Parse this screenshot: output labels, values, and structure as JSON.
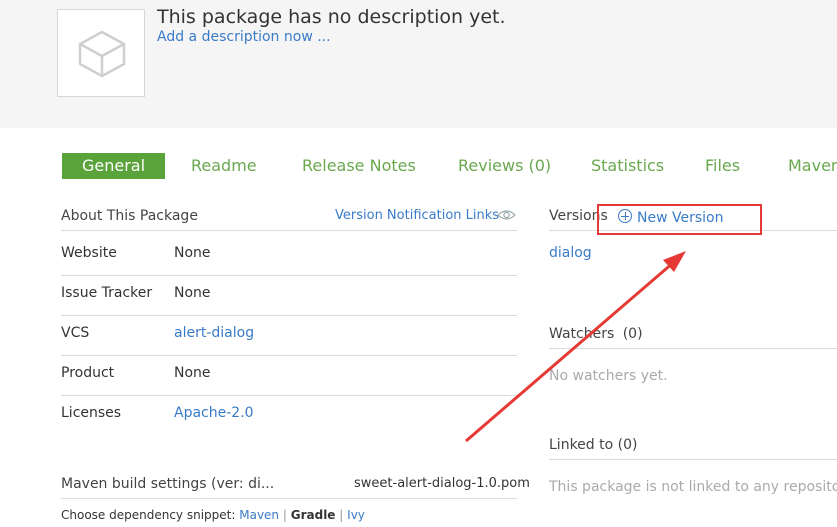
{
  "header": {
    "description": "This package has no description yet.",
    "add_description_link": "Add a description now ..."
  },
  "tabs": [
    {
      "label": "General",
      "active": true
    },
    {
      "label": "Readme"
    },
    {
      "label": "Release Notes"
    },
    {
      "label": "Reviews (0)"
    },
    {
      "label": "Statistics"
    },
    {
      "label": "Files"
    },
    {
      "label": "Maven"
    }
  ],
  "about": {
    "title": "About This Package",
    "notification_link": "Version Notification Links",
    "rows": [
      {
        "label": "Website",
        "value": "None"
      },
      {
        "label": "Issue Tracker",
        "value": "None"
      },
      {
        "label": "VCS",
        "value": "alert-dialog"
      },
      {
        "label": "Product",
        "value": "None"
      },
      {
        "label": "Licenses",
        "value": "Apache-2.0"
      }
    ]
  },
  "maven": {
    "title": "Maven build settings (ver: di...",
    "pom": "sweet-alert-dialog-1.0.pom",
    "snippet_prefix": "Choose dependency snippet:",
    "options": [
      "Maven",
      "Gradle",
      "Ivy"
    ],
    "selected": "Gradle",
    "separator": "|"
  },
  "versions": {
    "title": "Versions",
    "new_version": "New Version",
    "items": [
      "dialog"
    ]
  },
  "watchers": {
    "title": "Watchers",
    "count": "(0)",
    "empty": "No watchers yet."
  },
  "linked": {
    "title": "Linked to (0)",
    "empty": "This package is not linked to any repository y"
  },
  "colors": {
    "accent_green": "#5aa33a",
    "link_blue": "#3a7bc8",
    "annotation_red": "#e53935"
  }
}
